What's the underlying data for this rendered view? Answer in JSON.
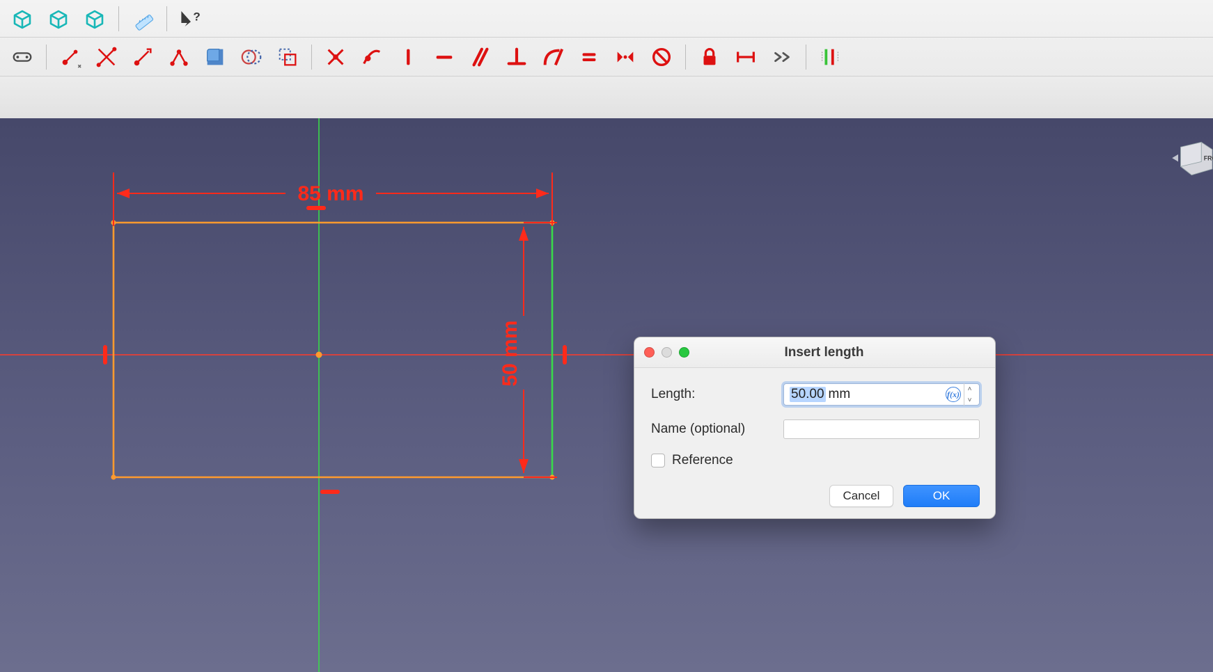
{
  "toolbar_top": {
    "items": [
      {
        "name": "axonometric-view-icon"
      },
      {
        "name": "isometric-view-icon"
      },
      {
        "name": "dimetric-view-icon"
      },
      {
        "divider": true
      },
      {
        "name": "measure-icon"
      },
      {
        "divider": true
      },
      {
        "name": "whats-this-icon"
      }
    ]
  },
  "toolbar_sketch": {
    "items": [
      {
        "name": "create-slot-icon"
      },
      {
        "divider": true
      },
      {
        "name": "create-point-icon",
        "dropdown": true
      },
      {
        "name": "trim-icon"
      },
      {
        "name": "extend-icon"
      },
      {
        "name": "split-icon"
      },
      {
        "name": "fillet-icon"
      },
      {
        "name": "create-box-icon"
      },
      {
        "name": "toggle-construction-icon"
      },
      {
        "name": "clone-icon"
      },
      {
        "divider": true
      },
      {
        "name": "coincident-constraint-icon"
      },
      {
        "name": "point-on-object-constraint-icon"
      },
      {
        "name": "vertical-constraint-icon"
      },
      {
        "name": "horizontal-constraint-icon"
      },
      {
        "name": "parallel-constraint-icon"
      },
      {
        "name": "perpendicular-constraint-icon"
      },
      {
        "name": "tangent-constraint-icon"
      },
      {
        "name": "equal-constraint-icon"
      },
      {
        "name": "symmetric-constraint-icon"
      },
      {
        "name": "block-constraint-icon"
      },
      {
        "divider": true
      },
      {
        "name": "lock-constraint-icon"
      },
      {
        "name": "horizontal-distance-icon"
      },
      {
        "name": "toolbar-overflow-icon"
      },
      {
        "divider": true
      },
      {
        "name": "toggle-virtual-space-icon"
      }
    ]
  },
  "sketch": {
    "dimensions": {
      "horizontal_label": "85 mm",
      "vertical_label": "50 mm"
    }
  },
  "navcube": {
    "face_label": "FRONT"
  },
  "dialog": {
    "title": "Insert length",
    "length_label": "Length:",
    "length_value_selected": "50.00",
    "length_unit": "mm",
    "name_label": "Name (optional)",
    "name_value": "",
    "reference_label": "Reference",
    "reference_checked": false,
    "cancel_label": "Cancel",
    "ok_label": "OK"
  }
}
